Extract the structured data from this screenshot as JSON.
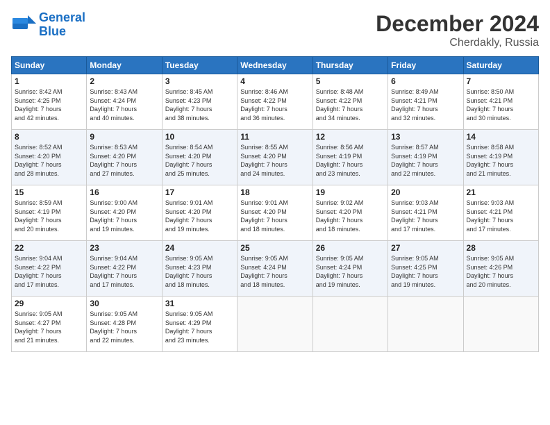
{
  "header": {
    "logo_line1": "General",
    "logo_line2": "Blue",
    "month": "December 2024",
    "location": "Cherdakly, Russia"
  },
  "days_of_week": [
    "Sunday",
    "Monday",
    "Tuesday",
    "Wednesday",
    "Thursday",
    "Friday",
    "Saturday"
  ],
  "weeks": [
    [
      {
        "day": "1",
        "info": "Sunrise: 8:42 AM\nSunset: 4:25 PM\nDaylight: 7 hours\nand 42 minutes."
      },
      {
        "day": "2",
        "info": "Sunrise: 8:43 AM\nSunset: 4:24 PM\nDaylight: 7 hours\nand 40 minutes."
      },
      {
        "day": "3",
        "info": "Sunrise: 8:45 AM\nSunset: 4:23 PM\nDaylight: 7 hours\nand 38 minutes."
      },
      {
        "day": "4",
        "info": "Sunrise: 8:46 AM\nSunset: 4:22 PM\nDaylight: 7 hours\nand 36 minutes."
      },
      {
        "day": "5",
        "info": "Sunrise: 8:48 AM\nSunset: 4:22 PM\nDaylight: 7 hours\nand 34 minutes."
      },
      {
        "day": "6",
        "info": "Sunrise: 8:49 AM\nSunset: 4:21 PM\nDaylight: 7 hours\nand 32 minutes."
      },
      {
        "day": "7",
        "info": "Sunrise: 8:50 AM\nSunset: 4:21 PM\nDaylight: 7 hours\nand 30 minutes."
      }
    ],
    [
      {
        "day": "8",
        "info": "Sunrise: 8:52 AM\nSunset: 4:20 PM\nDaylight: 7 hours\nand 28 minutes."
      },
      {
        "day": "9",
        "info": "Sunrise: 8:53 AM\nSunset: 4:20 PM\nDaylight: 7 hours\nand 27 minutes."
      },
      {
        "day": "10",
        "info": "Sunrise: 8:54 AM\nSunset: 4:20 PM\nDaylight: 7 hours\nand 25 minutes."
      },
      {
        "day": "11",
        "info": "Sunrise: 8:55 AM\nSunset: 4:20 PM\nDaylight: 7 hours\nand 24 minutes."
      },
      {
        "day": "12",
        "info": "Sunrise: 8:56 AM\nSunset: 4:19 PM\nDaylight: 7 hours\nand 23 minutes."
      },
      {
        "day": "13",
        "info": "Sunrise: 8:57 AM\nSunset: 4:19 PM\nDaylight: 7 hours\nand 22 minutes."
      },
      {
        "day": "14",
        "info": "Sunrise: 8:58 AM\nSunset: 4:19 PM\nDaylight: 7 hours\nand 21 minutes."
      }
    ],
    [
      {
        "day": "15",
        "info": "Sunrise: 8:59 AM\nSunset: 4:19 PM\nDaylight: 7 hours\nand 20 minutes."
      },
      {
        "day": "16",
        "info": "Sunrise: 9:00 AM\nSunset: 4:20 PM\nDaylight: 7 hours\nand 19 minutes."
      },
      {
        "day": "17",
        "info": "Sunrise: 9:01 AM\nSunset: 4:20 PM\nDaylight: 7 hours\nand 19 minutes."
      },
      {
        "day": "18",
        "info": "Sunrise: 9:01 AM\nSunset: 4:20 PM\nDaylight: 7 hours\nand 18 minutes."
      },
      {
        "day": "19",
        "info": "Sunrise: 9:02 AM\nSunset: 4:20 PM\nDaylight: 7 hours\nand 18 minutes."
      },
      {
        "day": "20",
        "info": "Sunrise: 9:03 AM\nSunset: 4:21 PM\nDaylight: 7 hours\nand 17 minutes."
      },
      {
        "day": "21",
        "info": "Sunrise: 9:03 AM\nSunset: 4:21 PM\nDaylight: 7 hours\nand 17 minutes."
      }
    ],
    [
      {
        "day": "22",
        "info": "Sunrise: 9:04 AM\nSunset: 4:22 PM\nDaylight: 7 hours\nand 17 minutes."
      },
      {
        "day": "23",
        "info": "Sunrise: 9:04 AM\nSunset: 4:22 PM\nDaylight: 7 hours\nand 17 minutes."
      },
      {
        "day": "24",
        "info": "Sunrise: 9:05 AM\nSunset: 4:23 PM\nDaylight: 7 hours\nand 18 minutes."
      },
      {
        "day": "25",
        "info": "Sunrise: 9:05 AM\nSunset: 4:24 PM\nDaylight: 7 hours\nand 18 minutes."
      },
      {
        "day": "26",
        "info": "Sunrise: 9:05 AM\nSunset: 4:24 PM\nDaylight: 7 hours\nand 19 minutes."
      },
      {
        "day": "27",
        "info": "Sunrise: 9:05 AM\nSunset: 4:25 PM\nDaylight: 7 hours\nand 19 minutes."
      },
      {
        "day": "28",
        "info": "Sunrise: 9:05 AM\nSunset: 4:26 PM\nDaylight: 7 hours\nand 20 minutes."
      }
    ],
    [
      {
        "day": "29",
        "info": "Sunrise: 9:05 AM\nSunset: 4:27 PM\nDaylight: 7 hours\nand 21 minutes."
      },
      {
        "day": "30",
        "info": "Sunrise: 9:05 AM\nSunset: 4:28 PM\nDaylight: 7 hours\nand 22 minutes."
      },
      {
        "day": "31",
        "info": "Sunrise: 9:05 AM\nSunset: 4:29 PM\nDaylight: 7 hours\nand 23 minutes."
      },
      null,
      null,
      null,
      null
    ]
  ]
}
